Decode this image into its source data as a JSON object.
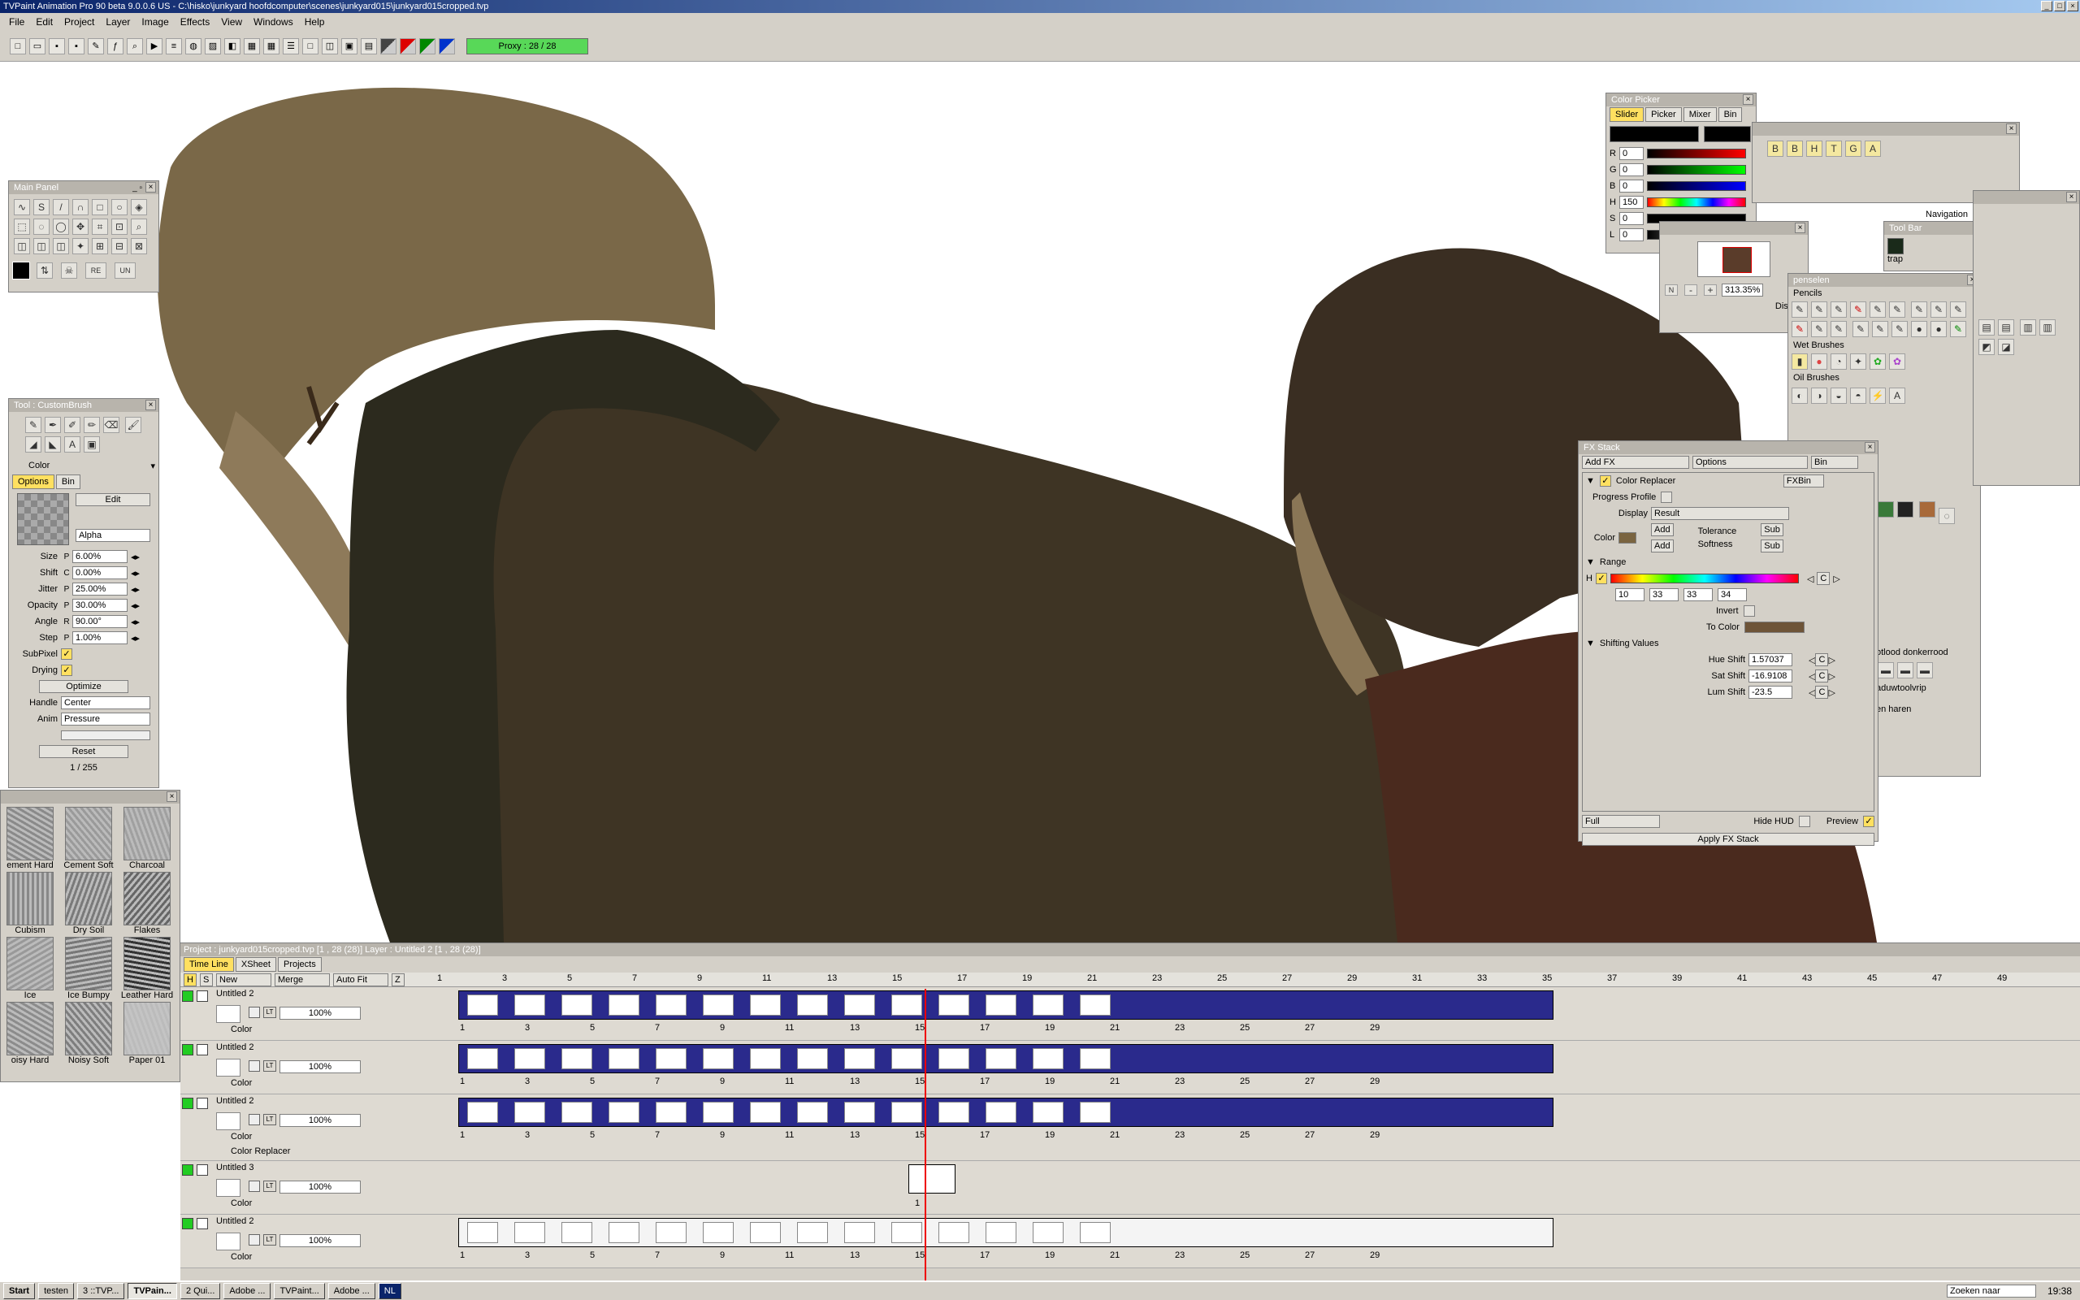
{
  "app": {
    "title": "TVPaint Animation Pro 90 beta 9.0.0.6 US - C:\\hisko\\junkyard hoofdcomputer\\scenes\\junkyard015\\junkyard015cropped.tvp"
  },
  "menu": [
    "File",
    "Edit",
    "Project",
    "Layer",
    "Image",
    "Effects",
    "View",
    "Windows",
    "Help"
  ],
  "toolbar": {
    "proxy": "Proxy : 28 / 28"
  },
  "main_panel": {
    "title": "Main Panel"
  },
  "custom_brush": {
    "title": "Tool : CustomBrush",
    "mode": "Color",
    "tabs": [
      "Options",
      "Bin"
    ],
    "edit": "Edit",
    "blend": "Alpha",
    "params": [
      {
        "label": "Size",
        "flag": "P",
        "value": "6.00%"
      },
      {
        "label": "Shift",
        "flag": "C",
        "value": "0.00%"
      },
      {
        "label": "Jitter",
        "flag": "P",
        "value": "25.00%"
      },
      {
        "label": "Opacity",
        "flag": "P",
        "value": "30.00%"
      },
      {
        "label": "Angle",
        "flag": "R",
        "value": "90.00°"
      },
      {
        "label": "Step",
        "flag": "P",
        "value": "1.00%"
      }
    ],
    "subpixel": "SubPixel",
    "drying": "Drying",
    "optimize": "Optimize",
    "handle_label": "Handle",
    "handle_value": "Center",
    "anim_label": "Anim",
    "anim_value": "Pressure",
    "reset": "Reset",
    "count": "1 / 255"
  },
  "textures": [
    {
      "name": "ement Hard"
    },
    {
      "name": "Cement Soft"
    },
    {
      "name": "Charcoal"
    },
    {
      "name": "Cubism"
    },
    {
      "name": "Dry Soil"
    },
    {
      "name": "Flakes"
    },
    {
      "name": "Ice"
    },
    {
      "name": "Ice Bumpy"
    },
    {
      "name": "Leather Hard"
    },
    {
      "name": "oisy Hard"
    },
    {
      "name": "Noisy Soft"
    },
    {
      "name": "Paper 01"
    }
  ],
  "color_picker": {
    "title": "Color Picker",
    "tabs": [
      "Slider",
      "Picker",
      "Mixer",
      "Bin"
    ],
    "channels": [
      {
        "label": "R",
        "value": "0",
        "color": "linear-gradient(90deg,#000,#f00)"
      },
      {
        "label": "G",
        "value": "0",
        "color": "linear-gradient(90deg,#000,#0f0)"
      },
      {
        "label": "B",
        "value": "0",
        "color": "linear-gradient(90deg,#000,#00f)"
      },
      {
        "label": "H",
        "value": "150",
        "color": "linear-gradient(90deg,#f00,#ff0,#0f0,#0ff,#00f,#f0f,#f00)"
      },
      {
        "label": "S",
        "value": "0",
        "color": "linear-gradient(90deg,#000,#000)"
      },
      {
        "label": "L",
        "value": "0",
        "color": "linear-gradient(90deg,#000,#fff)"
      }
    ]
  },
  "navigation": {
    "title": "Navigation",
    "zoom": "313.35%",
    "display": "Display"
  },
  "tool_bar": {
    "title": "Tool Bar",
    "item": "trap"
  },
  "penselen": {
    "title": "penselen",
    "sections": [
      "Pencils",
      "Wet Brushes",
      "Oil Brushes"
    ],
    "extra": [
      "otlood donkerrood",
      "aduwtoolvrip",
      "en haren"
    ]
  },
  "fx_stack": {
    "title": "FX Stack",
    "add_fx": "Add FX",
    "options": "Options",
    "bin": "Bin",
    "effect": "Color Replacer",
    "fxbin": "FXBin",
    "progress": "Progress Profile",
    "display_label": "Display",
    "display_value": "Result",
    "color_label": "Color",
    "add": "Add",
    "tolerance": "Tolerance",
    "softness": "Softness",
    "sub": "Sub",
    "range": "Range",
    "h": "H",
    "range_vals": [
      "10",
      "33",
      "33",
      "34"
    ],
    "invert": "Invert",
    "to_color": "To Color",
    "shifting": "Shifting Values",
    "shifts": [
      {
        "label": "Hue Shift",
        "value": "1.57037"
      },
      {
        "label": "Sat Shift",
        "value": "-16.9108"
      },
      {
        "label": "Lum Shift",
        "value": "-23.5"
      }
    ],
    "c": "C",
    "quality": "Full",
    "hide_hud": "Hide HUD",
    "preview": "Preview",
    "apply": "Apply FX Stack"
  },
  "timeline": {
    "header": "Project : junkyard015cropped.tvp [1 , 28 (28)]     Layer : Untitled 2 [1 , 28 (28)]",
    "tabs": [
      "Time Line",
      "XSheet",
      "Projects"
    ],
    "cols": {
      "h": "H",
      "s": "S",
      "new": "New",
      "merge": "Merge",
      "autofit": "Auto Fit",
      "z": "Z"
    },
    "ruler": [
      "1",
      "3",
      "5",
      "7",
      "9",
      "11",
      "13",
      "15",
      "17",
      "19",
      "21",
      "23",
      "25",
      "27",
      "29",
      "31",
      "33",
      "35",
      "37",
      "39",
      "41",
      "43",
      "45",
      "47",
      "49"
    ],
    "layers": [
      {
        "name": "Untitled 2",
        "opacity": "100%",
        "mode": "Color"
      },
      {
        "name": "Untitled 2",
        "opacity": "100%",
        "mode": "Color"
      },
      {
        "name": "Untitled 2",
        "opacity": "100%",
        "mode": "Color",
        "fx": "Color Replacer"
      },
      {
        "name": "Untitled 3",
        "opacity": "100%",
        "mode": "Color"
      },
      {
        "name": "Untitled 2",
        "opacity": "100%",
        "mode": "Color"
      }
    ],
    "frame_labels": [
      "1",
      "3",
      "5",
      "7",
      "9",
      "11",
      "13",
      "15",
      "17",
      "19",
      "21",
      "23",
      "25",
      "27",
      "29"
    ],
    "single_frame": "1"
  },
  "taskbar": {
    "start": "Start",
    "items": [
      "testen",
      "3 ::TVP...",
      "TVPain...",
      "2 Qui...",
      "Adobe ...",
      "TVPaint...",
      "Adobe ...",
      "NL"
    ],
    "search": "Zoeken naar",
    "clock": "19:38"
  }
}
